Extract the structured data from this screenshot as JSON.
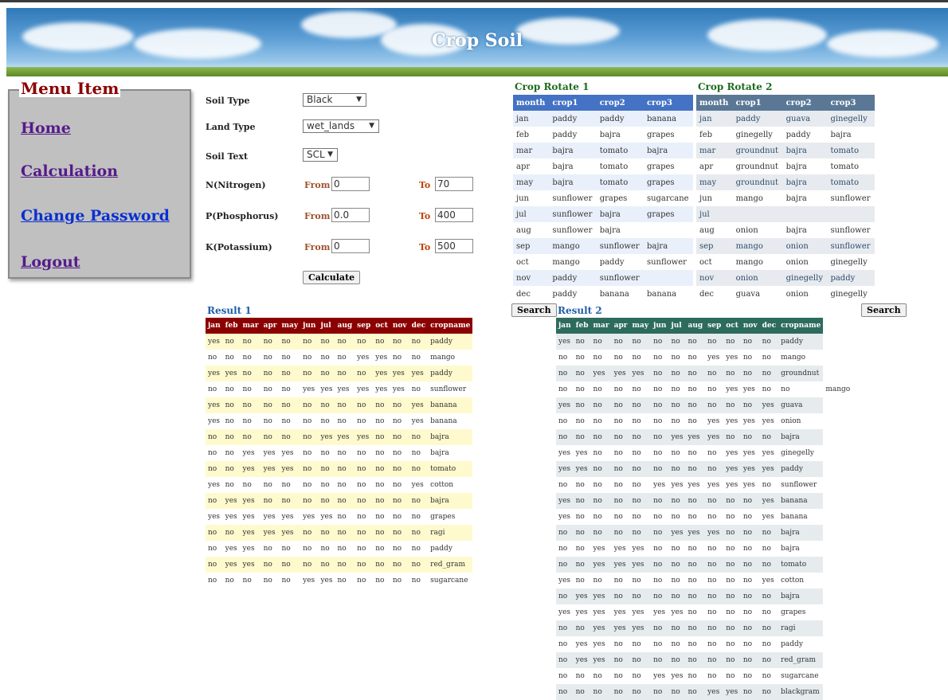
{
  "app": {
    "title": "Crop Soil"
  },
  "menu": {
    "legend": "Menu Item",
    "items": [
      "Home",
      "Calculation",
      "Change Password",
      "Logout"
    ]
  },
  "form": {
    "soil_type_label": "Soil Type",
    "soil_type_value": "Black",
    "land_type_label": "Land Type",
    "land_type_value": "wet_lands",
    "soil_text_label": "Soil Text",
    "soil_text_value": "SCL",
    "from_label": "From",
    "to_label": "To",
    "nitrogen": {
      "label": "N(Nitrogen)",
      "from": "0",
      "to": "70"
    },
    "phosphorus": {
      "label": "P(Phosphorus)",
      "from": "0.0",
      "to": "400"
    },
    "potassium": {
      "label": "K(Potassium)",
      "from": "0",
      "to": "500"
    },
    "calculate_label": "Calculate"
  },
  "search_label": "Search",
  "rotate1": {
    "title": "Crop Rotate 1",
    "headers": [
      "month",
      "crop1",
      "crop2",
      "crop3"
    ],
    "rows": [
      [
        "jan",
        "paddy",
        "paddy",
        "banana"
      ],
      [
        "feb",
        "paddy",
        "bajra",
        "grapes"
      ],
      [
        "mar",
        "bajra",
        "tomato",
        "bajra"
      ],
      [
        "apr",
        "bajra",
        "tomato",
        "grapes"
      ],
      [
        "may",
        "bajra",
        "tomato",
        "grapes"
      ],
      [
        "jun",
        "sunflower",
        "grapes",
        "sugarcane"
      ],
      [
        "jul",
        "sunflower",
        "bajra",
        "grapes"
      ],
      [
        "aug",
        "sunflower",
        "bajra",
        ""
      ],
      [
        "sep",
        "mango",
        "sunflower",
        "bajra"
      ],
      [
        "oct",
        "mango",
        "paddy",
        "sunflower"
      ],
      [
        "nov",
        "paddy",
        "sunflower",
        ""
      ],
      [
        "dec",
        "paddy",
        "banana",
        "banana"
      ]
    ]
  },
  "rotate2": {
    "title": "Crop Rotate 2",
    "headers": [
      "month",
      "crop1",
      "crop2",
      "crop3"
    ],
    "rows": [
      [
        "jan",
        "paddy",
        "guava",
        "ginegelly"
      ],
      [
        "feb",
        "ginegelly",
        "paddy",
        "bajra"
      ],
      [
        "mar",
        "groundnut",
        "bajra",
        "tomato"
      ],
      [
        "apr",
        "groundnut",
        "bajra",
        "tomato"
      ],
      [
        "may",
        "groundnut",
        "bajra",
        "tomato"
      ],
      [
        "jun",
        "mango",
        "bajra",
        "sunflower"
      ],
      [
        "jul",
        "",
        "",
        ""
      ],
      [
        "aug",
        "onion",
        "bajra",
        "sunflower"
      ],
      [
        "sep",
        "mango",
        "onion",
        "sunflower"
      ],
      [
        "oct",
        "mango",
        "onion",
        "ginegelly"
      ],
      [
        "nov",
        "onion",
        "ginegelly",
        "paddy"
      ],
      [
        "dec",
        "guava",
        "onion",
        "ginegelly"
      ]
    ]
  },
  "result1": {
    "title": "Result 1",
    "headers": [
      "jan",
      "feb",
      "mar",
      "apr",
      "may",
      "jun",
      "jul",
      "aug",
      "sep",
      "oct",
      "nov",
      "dec",
      "cropname"
    ],
    "rows": [
      [
        "yes",
        "no",
        "no",
        "no",
        "no",
        "no",
        "no",
        "no",
        "no",
        "no",
        "no",
        "no",
        "paddy"
      ],
      [
        "no",
        "no",
        "no",
        "no",
        "no",
        "no",
        "no",
        "no",
        "yes",
        "yes",
        "no",
        "no",
        "mango"
      ],
      [
        "yes",
        "yes",
        "no",
        "no",
        "no",
        "no",
        "no",
        "no",
        "no",
        "yes",
        "yes",
        "yes",
        "paddy"
      ],
      [
        "no",
        "no",
        "no",
        "no",
        "no",
        "yes",
        "yes",
        "yes",
        "yes",
        "yes",
        "yes",
        "no",
        "sunflower"
      ],
      [
        "yes",
        "no",
        "no",
        "no",
        "no",
        "no",
        "no",
        "no",
        "no",
        "no",
        "no",
        "yes",
        "banana"
      ],
      [
        "yes",
        "no",
        "no",
        "no",
        "no",
        "no",
        "no",
        "no",
        "no",
        "no",
        "no",
        "yes",
        "banana"
      ],
      [
        "no",
        "no",
        "no",
        "no",
        "no",
        "no",
        "yes",
        "yes",
        "yes",
        "no",
        "no",
        "no",
        "bajra"
      ],
      [
        "no",
        "no",
        "yes",
        "yes",
        "yes",
        "no",
        "no",
        "no",
        "no",
        "no",
        "no",
        "no",
        "bajra"
      ],
      [
        "no",
        "no",
        "yes",
        "yes",
        "yes",
        "no",
        "no",
        "no",
        "no",
        "no",
        "no",
        "no",
        "tomato"
      ],
      [
        "yes",
        "no",
        "no",
        "no",
        "no",
        "no",
        "no",
        "no",
        "no",
        "no",
        "no",
        "yes",
        "cotton"
      ],
      [
        "no",
        "yes",
        "yes",
        "no",
        "no",
        "no",
        "no",
        "no",
        "no",
        "no",
        "no",
        "no",
        "bajra"
      ],
      [
        "yes",
        "yes",
        "yes",
        "yes",
        "yes",
        "yes",
        "yes",
        "no",
        "no",
        "no",
        "no",
        "no",
        "grapes"
      ],
      [
        "no",
        "no",
        "yes",
        "yes",
        "yes",
        "no",
        "no",
        "no",
        "no",
        "no",
        "no",
        "no",
        "ragi"
      ],
      [
        "no",
        "yes",
        "yes",
        "no",
        "no",
        "no",
        "no",
        "no",
        "no",
        "no",
        "no",
        "no",
        "paddy"
      ],
      [
        "no",
        "yes",
        "yes",
        "no",
        "no",
        "no",
        "no",
        "no",
        "no",
        "no",
        "no",
        "no",
        "red_gram"
      ],
      [
        "no",
        "no",
        "no",
        "no",
        "no",
        "yes",
        "yes",
        "no",
        "no",
        "no",
        "no",
        "no",
        "sugarcane"
      ]
    ]
  },
  "result2": {
    "title": "Result 2",
    "headers": [
      "jan",
      "feb",
      "mar",
      "apr",
      "may",
      "jun",
      "jul",
      "aug",
      "sep",
      "oct",
      "nov",
      "dec",
      "cropname"
    ],
    "rows": [
      [
        "yes",
        "no",
        "no",
        "no",
        "no",
        "no",
        "no",
        "no",
        "no",
        "no",
        "no",
        "no",
        "paddy"
      ],
      [
        "no",
        "no",
        "no",
        "no",
        "no",
        "no",
        "no",
        "no",
        "yes",
        "yes",
        "no",
        "no",
        "mango"
      ],
      [
        "no",
        "no",
        "yes",
        "yes",
        "yes",
        "no",
        "no",
        "no",
        "no",
        "no",
        "no",
        "no",
        "groundnut"
      ],
      [
        "no",
        "no",
        "no",
        "no",
        "no",
        "no",
        "no",
        "no",
        "no",
        "yes",
        "yes",
        "no",
        "no",
        "mango"
      ],
      [
        "yes",
        "no",
        "no",
        "no",
        "no",
        "no",
        "no",
        "no",
        "no",
        "no",
        "no",
        "yes",
        "guava"
      ],
      [
        "no",
        "no",
        "no",
        "no",
        "no",
        "no",
        "no",
        "no",
        "yes",
        "yes",
        "yes",
        "yes",
        "onion"
      ],
      [
        "no",
        "no",
        "no",
        "no",
        "no",
        "no",
        "yes",
        "yes",
        "yes",
        "no",
        "no",
        "no",
        "bajra"
      ],
      [
        "yes",
        "yes",
        "no",
        "no",
        "no",
        "no",
        "no",
        "no",
        "no",
        "yes",
        "yes",
        "yes",
        "ginegelly"
      ],
      [
        "yes",
        "yes",
        "no",
        "no",
        "no",
        "no",
        "no",
        "no",
        "no",
        "yes",
        "yes",
        "yes",
        "paddy"
      ],
      [
        "no",
        "no",
        "no",
        "no",
        "no",
        "yes",
        "yes",
        "yes",
        "yes",
        "yes",
        "yes",
        "no",
        "sunflower"
      ],
      [
        "yes",
        "no",
        "no",
        "no",
        "no",
        "no",
        "no",
        "no",
        "no",
        "no",
        "no",
        "yes",
        "banana"
      ],
      [
        "yes",
        "no",
        "no",
        "no",
        "no",
        "no",
        "no",
        "no",
        "no",
        "no",
        "no",
        "yes",
        "banana"
      ],
      [
        "no",
        "no",
        "no",
        "no",
        "no",
        "no",
        "yes",
        "yes",
        "yes",
        "no",
        "no",
        "no",
        "bajra"
      ],
      [
        "no",
        "no",
        "yes",
        "yes",
        "yes",
        "no",
        "no",
        "no",
        "no",
        "no",
        "no",
        "no",
        "bajra"
      ],
      [
        "no",
        "no",
        "yes",
        "yes",
        "yes",
        "no",
        "no",
        "no",
        "no",
        "no",
        "no",
        "no",
        "tomato"
      ],
      [
        "yes",
        "no",
        "no",
        "no",
        "no",
        "no",
        "no",
        "no",
        "no",
        "no",
        "no",
        "yes",
        "cotton"
      ],
      [
        "no",
        "yes",
        "yes",
        "no",
        "no",
        "no",
        "no",
        "no",
        "no",
        "no",
        "no",
        "no",
        "bajra"
      ],
      [
        "yes",
        "yes",
        "yes",
        "yes",
        "yes",
        "yes",
        "yes",
        "no",
        "no",
        "no",
        "no",
        "no",
        "grapes"
      ],
      [
        "no",
        "no",
        "yes",
        "yes",
        "yes",
        "no",
        "no",
        "no",
        "no",
        "no",
        "no",
        "no",
        "ragi"
      ],
      [
        "no",
        "yes",
        "yes",
        "no",
        "no",
        "no",
        "no",
        "no",
        "no",
        "no",
        "no",
        "no",
        "paddy"
      ],
      [
        "no",
        "yes",
        "yes",
        "no",
        "no",
        "no",
        "no",
        "no",
        "no",
        "no",
        "no",
        "no",
        "red_gram"
      ],
      [
        "no",
        "no",
        "no",
        "no",
        "no",
        "yes",
        "yes",
        "no",
        "no",
        "no",
        "no",
        "no",
        "sugarcane"
      ],
      [
        "no",
        "no",
        "no",
        "no",
        "no",
        "no",
        "no",
        "no",
        "yes",
        "yes",
        "no",
        "no",
        "blackgram"
      ]
    ]
  }
}
